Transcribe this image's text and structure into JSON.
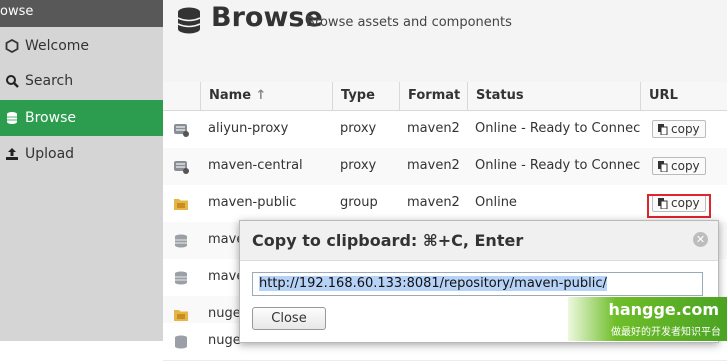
{
  "sidebar": {
    "header": "owse",
    "items": [
      {
        "label": "Welcome",
        "icon": "hexagon-icon"
      },
      {
        "label": "Search",
        "icon": "search-icon"
      },
      {
        "label": "Browse",
        "icon": "database-icon",
        "active": true
      },
      {
        "label": "Upload",
        "icon": "upload-icon"
      }
    ]
  },
  "page": {
    "title": "Browse",
    "subtitle": "Browse assets and components"
  },
  "table": {
    "columns": [
      "Name",
      "Type",
      "Format",
      "Status",
      "URL"
    ],
    "sort_indicator": "↑",
    "rows": [
      {
        "name": "aliyun-proxy",
        "type": "proxy",
        "format": "maven2",
        "status": "Online - Ready to Connect",
        "url_button": "copy",
        "icon": "proxy-repo-icon"
      },
      {
        "name": "maven-central",
        "type": "proxy",
        "format": "maven2",
        "status": "Online - Ready to Connect",
        "url_button": "copy",
        "icon": "proxy-repo-icon"
      },
      {
        "name": "maven-public",
        "type": "group",
        "format": "maven2",
        "status": "Online",
        "url_button": "copy",
        "icon": "group-repo-icon"
      },
      {
        "name": "mave",
        "icon": "hosted-repo-icon"
      },
      {
        "name": "mave",
        "icon": "hosted-repo-icon"
      },
      {
        "name": "nuge",
        "icon": "group-repo-icon"
      },
      {
        "name": "nuge",
        "icon": "hosted-repo-icon"
      }
    ]
  },
  "modal": {
    "title": "Copy to clipboard: ⌘+C, Enter",
    "url_value": "http://192.168.60.133:8081/repository/maven-public/",
    "close_label": "Close"
  },
  "watermark": {
    "line1": "hangge.com",
    "line2": "做最好的开发者知识平台"
  },
  "colors": {
    "active_green": "#2c9d4f",
    "highlight_red": "#e0242b"
  }
}
